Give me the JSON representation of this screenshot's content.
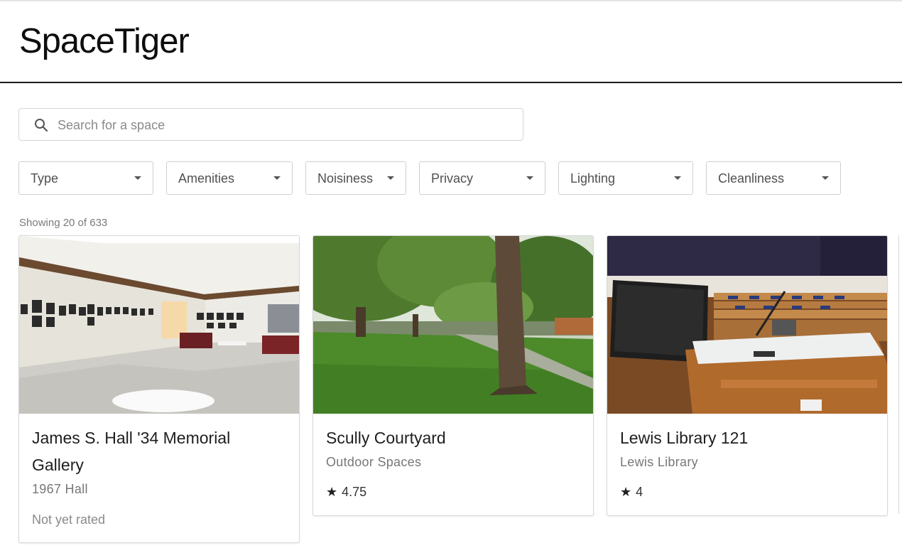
{
  "app": {
    "title": "SpaceTiger"
  },
  "search": {
    "placeholder": "Search for a space",
    "value": "",
    "icon": "search-icon"
  },
  "filters": [
    {
      "label": "Type"
    },
    {
      "label": "Amenities"
    },
    {
      "label": "Noisiness"
    },
    {
      "label": "Privacy"
    },
    {
      "label": "Lighting"
    },
    {
      "label": "Cleanliness"
    }
  ],
  "results": {
    "summary": "Showing 20 of 633"
  },
  "cards": [
    {
      "title": "James S. Hall '34 Memorial Gallery",
      "building": "1967 Hall",
      "rating": "Not yet rated",
      "rated": false
    },
    {
      "title": "Scully Courtyard",
      "building": "Outdoor Spaces",
      "rating": "4.75",
      "rated": true
    },
    {
      "title": "Lewis Library 121",
      "building": "Lewis Library",
      "rating": "4",
      "rated": true
    }
  ],
  "icons": {
    "search": "search-icon",
    "dropdown": "chevron-down-icon",
    "star": "star-icon"
  }
}
